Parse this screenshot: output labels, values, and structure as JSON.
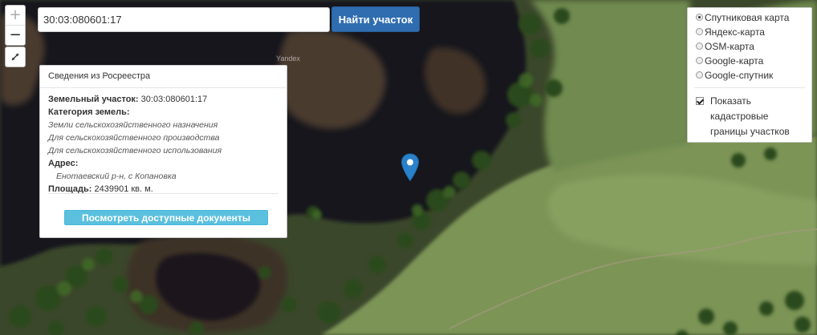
{
  "search": {
    "value": "30:03:080601:17",
    "button_label": "Найти участок"
  },
  "zoom": {
    "in_label": "+",
    "out_label": "−"
  },
  "map": {
    "attribution": "Yandex"
  },
  "info_panel": {
    "title": "Сведения из Росреестра",
    "parcel_label": "Земельный участок:",
    "parcel_value": "30:03:080601:17",
    "category_label": "Категория земель:",
    "categories": [
      "Земли сельскохозяйственного назначения",
      "Для сельскохозяйственного производства",
      "Для сельскохозяйственного использования"
    ],
    "address_label": "Адрес:",
    "address_value": "Енотаевский р-н, с Копановка",
    "area_label": "Площадь:",
    "area_value": "2439901 кв. м.",
    "docs_button": "Посмотреть доступные документы"
  },
  "layers": {
    "options": [
      {
        "label": "Спутниковая карта",
        "selected": true
      },
      {
        "label": "Яндекс-карта",
        "selected": false
      },
      {
        "label": "OSM-карта",
        "selected": false
      },
      {
        "label": "Google-карта",
        "selected": false
      },
      {
        "label": "Google-спутник",
        "selected": false
      }
    ],
    "cadastre_label": "Показать кадастровые границы участков",
    "cadastre_checked": true
  },
  "colors": {
    "primary_button": "#2f6db0",
    "info_button": "#5bc0de",
    "marker": "#2a81cb",
    "water": "#16131a",
    "field": "#7a9256",
    "forest": "#2d4b1e"
  },
  "icons": {
    "fullscreen": "expand-arrows-icon",
    "marker": "map-pin-icon"
  }
}
